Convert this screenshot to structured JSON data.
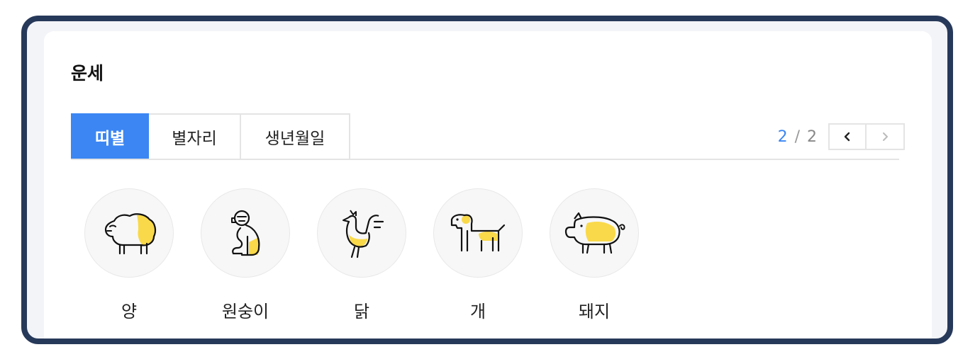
{
  "section": {
    "title": "운세"
  },
  "tabs": [
    {
      "label": "띠별",
      "active": true
    },
    {
      "label": "별자리",
      "active": false
    },
    {
      "label": "생년월일",
      "active": false
    }
  ],
  "pager": {
    "current": "2",
    "separator": "/",
    "total": "2"
  },
  "zodiac": [
    {
      "label": "양",
      "icon": "sheep-icon"
    },
    {
      "label": "원숭이",
      "icon": "monkey-icon"
    },
    {
      "label": "닭",
      "icon": "rooster-icon"
    },
    {
      "label": "개",
      "icon": "dog-icon"
    },
    {
      "label": "돼지",
      "icon": "pig-icon"
    }
  ],
  "colors": {
    "accent": "#3b86f3",
    "highlight": "#f9d949",
    "frame": "#27395a"
  }
}
